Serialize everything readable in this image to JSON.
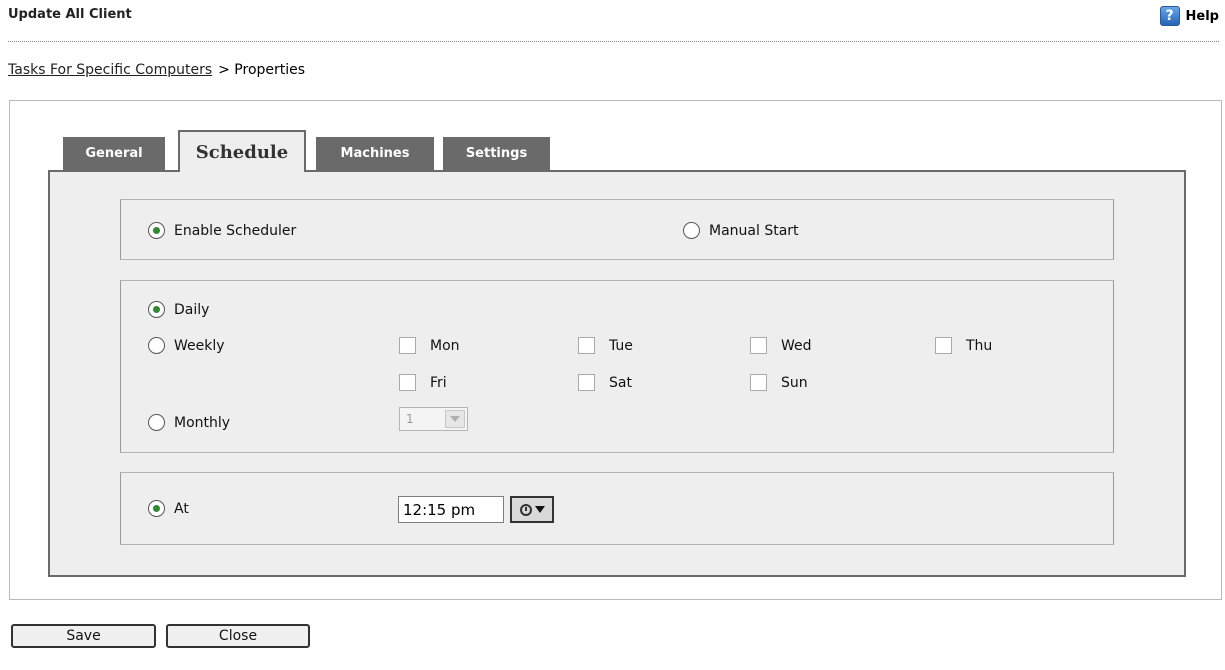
{
  "header": {
    "title": "Update All Client",
    "help_label": "Help",
    "help_icon": "help-icon"
  },
  "breadcrumb": {
    "link": "Tasks For Specific Computers",
    "current": "> Properties"
  },
  "tabs": [
    {
      "label": "General",
      "active": false
    },
    {
      "label": "Schedule",
      "active": true
    },
    {
      "label": "Machines",
      "active": false
    },
    {
      "label": "Settings",
      "active": false
    }
  ],
  "mode": {
    "enable_scheduler": {
      "label": "Enable Scheduler",
      "checked": true
    },
    "manual_start": {
      "label": "Manual Start",
      "checked": false
    }
  },
  "frequency": {
    "daily": {
      "label": "Daily",
      "checked": true
    },
    "weekly": {
      "label": "Weekly",
      "checked": false
    },
    "monthly": {
      "label": "Monthly",
      "checked": false
    },
    "days": [
      {
        "label": "Mon",
        "checked": false
      },
      {
        "label": "Tue",
        "checked": false
      },
      {
        "label": "Wed",
        "checked": false
      },
      {
        "label": "Thu",
        "checked": false
      },
      {
        "label": "Fri",
        "checked": false
      },
      {
        "label": "Sat",
        "checked": false
      },
      {
        "label": "Sun",
        "checked": false
      }
    ],
    "monthly_day": {
      "selected": "1",
      "disabled": true
    }
  },
  "time": {
    "at_label": "At",
    "at_checked": true,
    "value": "12:15 pm",
    "picker_icon": "clock-icon"
  },
  "actions": {
    "save": "Save",
    "close": "Close"
  },
  "colors": {
    "tab_inactive": "#6a6a6a",
    "panel_bg": "#eeeeee",
    "radio_dot": "#2f8a2f"
  }
}
